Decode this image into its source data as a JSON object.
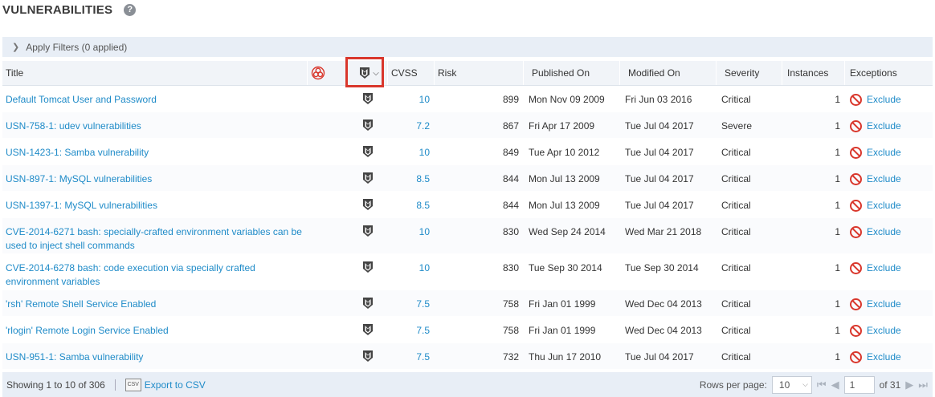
{
  "header": {
    "title": "VULNERABILITIES",
    "help": "?"
  },
  "filters": {
    "label": "Apply Filters (0 applied)"
  },
  "columns": {
    "title": "Title",
    "cvss": "CVSS",
    "risk": "Risk",
    "published": "Published On",
    "modified": "Modified On",
    "severity": "Severity",
    "instances": "Instances",
    "exceptions": "Exceptions"
  },
  "rows": [
    {
      "title": "Default Tomcat User and Password",
      "cvss": "10",
      "risk": "899",
      "published": "Mon Nov 09 2009",
      "modified": "Fri Jun 03 2016",
      "severity": "Critical",
      "instances": "1",
      "exception": "Exclude"
    },
    {
      "title": "USN-758-1: udev vulnerabilities",
      "cvss": "7.2",
      "risk": "867",
      "published": "Fri Apr 17 2009",
      "modified": "Tue Jul 04 2017",
      "severity": "Severe",
      "instances": "1",
      "exception": "Exclude"
    },
    {
      "title": "USN-1423-1: Samba vulnerability",
      "cvss": "10",
      "risk": "849",
      "published": "Tue Apr 10 2012",
      "modified": "Tue Jul 04 2017",
      "severity": "Critical",
      "instances": "1",
      "exception": "Exclude"
    },
    {
      "title": "USN-897-1: MySQL vulnerabilities",
      "cvss": "8.5",
      "risk": "844",
      "published": "Mon Jul 13 2009",
      "modified": "Tue Jul 04 2017",
      "severity": "Critical",
      "instances": "1",
      "exception": "Exclude"
    },
    {
      "title": "USN-1397-1: MySQL vulnerabilities",
      "cvss": "8.5",
      "risk": "844",
      "published": "Mon Jul 13 2009",
      "modified": "Tue Jul 04 2017",
      "severity": "Critical",
      "instances": "1",
      "exception": "Exclude"
    },
    {
      "title": "CVE-2014-6271 bash: specially-crafted environment variables can be used to inject shell commands",
      "cvss": "10",
      "risk": "830",
      "published": "Wed Sep 24 2014",
      "modified": "Wed Mar 21 2018",
      "severity": "Critical",
      "instances": "1",
      "exception": "Exclude"
    },
    {
      "title": "CVE-2014-6278 bash: code execution via specially crafted environment variables",
      "cvss": "10",
      "risk": "830",
      "published": "Tue Sep 30 2014",
      "modified": "Tue Sep 30 2014",
      "severity": "Critical",
      "instances": "1",
      "exception": "Exclude"
    },
    {
      "title": "'rsh' Remote Shell Service Enabled",
      "cvss": "7.5",
      "risk": "758",
      "published": "Fri Jan 01 1999",
      "modified": "Wed Dec 04 2013",
      "severity": "Critical",
      "instances": "1",
      "exception": "Exclude"
    },
    {
      "title": "'rlogin' Remote Login Service Enabled",
      "cvss": "7.5",
      "risk": "758",
      "published": "Fri Jan 01 1999",
      "modified": "Wed Dec 04 2013",
      "severity": "Critical",
      "instances": "1",
      "exception": "Exclude"
    },
    {
      "title": "USN-951-1: Samba vulnerability",
      "cvss": "7.5",
      "risk": "732",
      "published": "Thu Jun 17 2010",
      "modified": "Tue Jul 04 2017",
      "severity": "Critical",
      "instances": "1",
      "exception": "Exclude"
    }
  ],
  "footer": {
    "showing": "Showing 1 to 10 of 306",
    "export": "Export to CSV",
    "rows_per_page_label": "Rows per page:",
    "rows_per_page": "10",
    "page": "1",
    "of_pages": "of 31"
  },
  "colors": {
    "link": "#1f8bc8",
    "highlight": "#d9372c",
    "exclude": "#d9372c"
  },
  "icons": {
    "biohazard": "biohazard-icon",
    "metasploit": "metasploit-icon",
    "exclude": "ban-icon"
  }
}
